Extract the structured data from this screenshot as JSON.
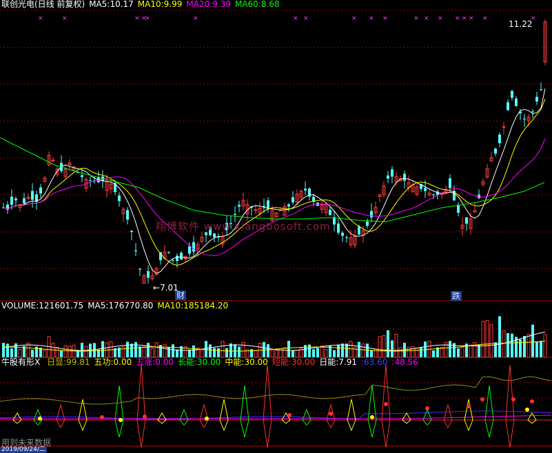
{
  "header_main": {
    "stock": "联创光电(日线 前复权)",
    "ma5_label": "MA5:",
    "ma5": "10.17",
    "ma10_label": "MA10:",
    "ma10": "9.99",
    "ma20_label": "MA20:",
    "ma20": "9.39",
    "ma60_label": "MA60:",
    "ma60": "8.68"
  },
  "header_volume": {
    "vol_label": "VOLUME:",
    "vol": "121601.75",
    "ma5_label": "MA5:",
    "ma5": "176770.80",
    "ma10_label": "MA10:",
    "ma10": "185184.20"
  },
  "header_indicator": {
    "name": "牛股有形X",
    "items": [
      {
        "label": "日显:",
        "value": "99.81",
        "color": "#c0c000"
      },
      {
        "label": "五功:",
        "value": "0.00",
        "color": "#ffff00"
      },
      {
        "label": "五涨:",
        "value": "0.00",
        "color": "#ff00ff"
      },
      {
        "label": "长能:",
        "value": "30.00",
        "color": "#00ff00"
      },
      {
        "label": "中能:",
        "value": "30.00",
        "color": "#ffff00"
      },
      {
        "label": "短能:",
        "value": "30.00",
        "color": "#ff3030"
      },
      {
        "label": "日能:",
        "value": "7.91",
        "color": "#ffffff"
      },
      {
        "label": ":",
        "value": "63.60",
        "color": "#4040ff"
      },
      {
        "label": ":",
        "value": "48.56",
        "color": "#ff00ff"
      }
    ]
  },
  "annotations": {
    "high_label": "11.22",
    "low_label": "7.01",
    "signal_cai": "财",
    "signal_die": "跌"
  },
  "watermark": "翔博软件 www.xiangbosoft.com",
  "footer_text": "用到未来数据",
  "date_label": "2019/09/24/二",
  "colors": {
    "up": "#ff3b3b",
    "down": "#54ffff",
    "ma5": "#ffffff",
    "ma10": "#ffff00",
    "ma20": "#ff00ff",
    "ma60": "#00ff00",
    "grid": "#a00000",
    "frame": "#c00000"
  },
  "chart_data": {
    "type": "candlestick",
    "y_range": [
      6.8,
      11.4
    ],
    "candles": [],
    "seed_note_removed": true
  }
}
